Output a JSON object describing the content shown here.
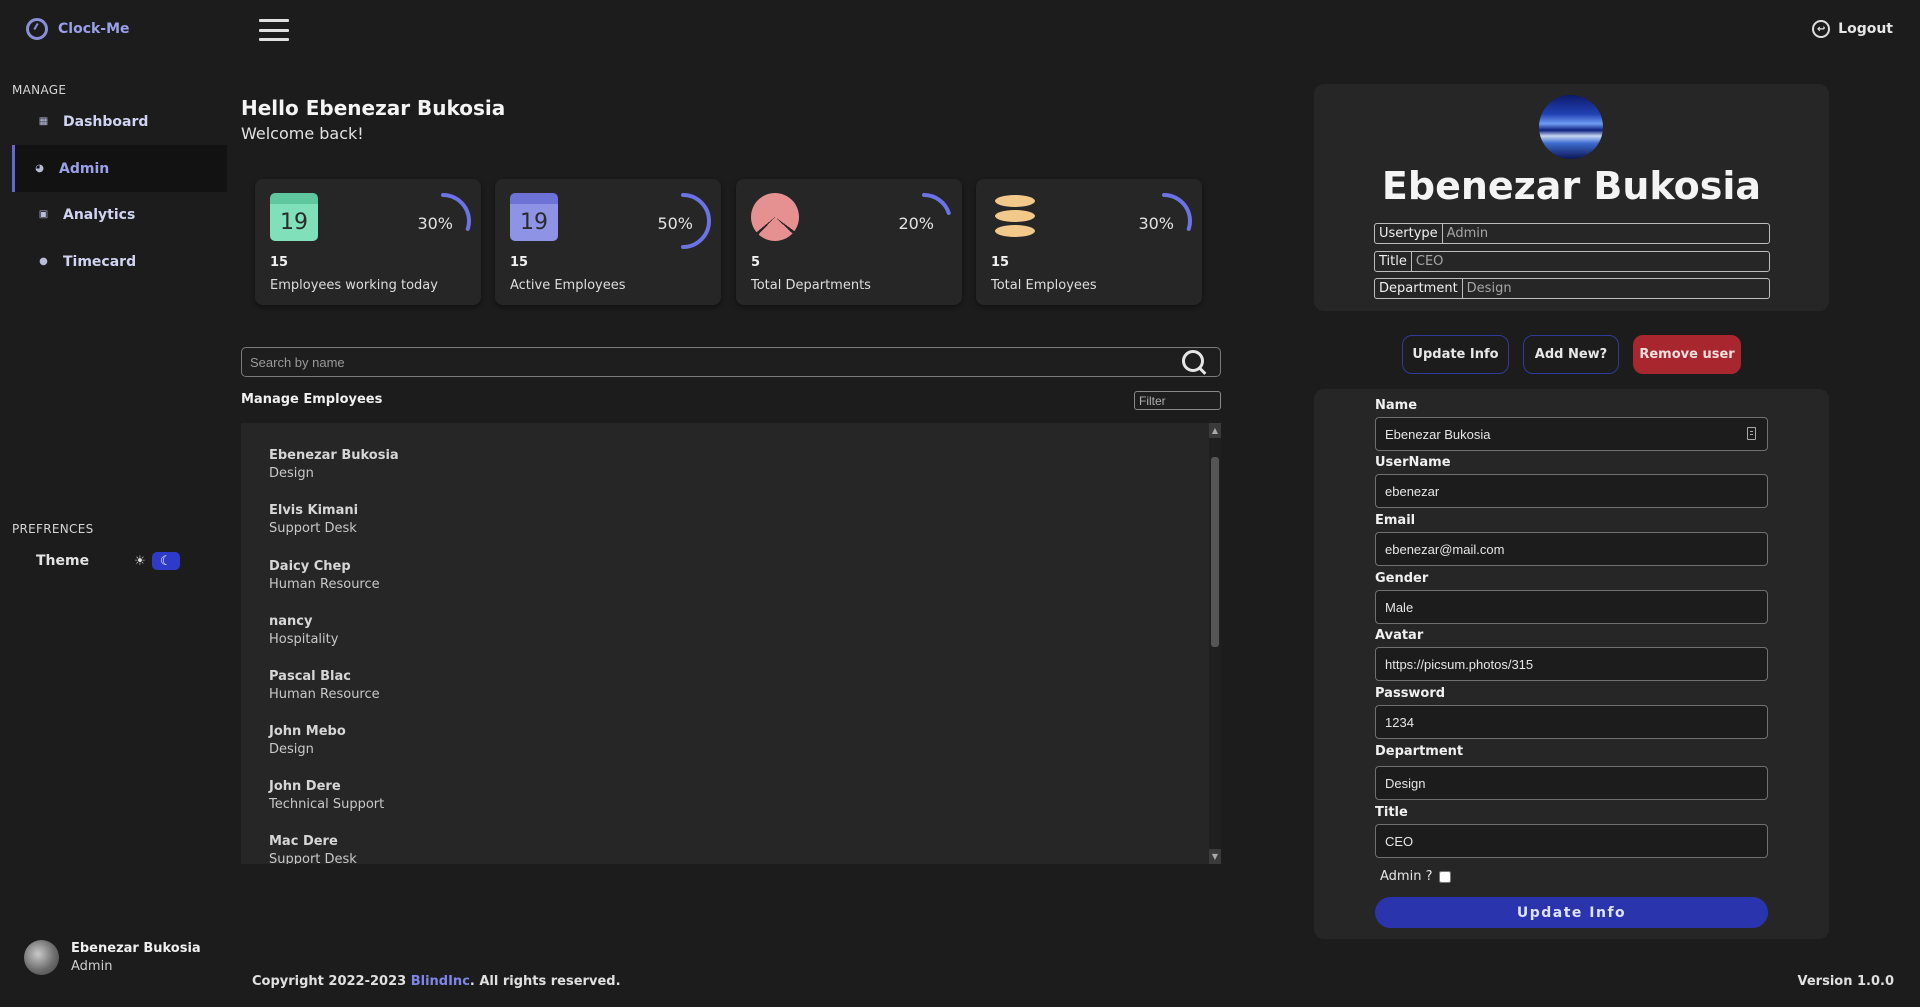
{
  "brand": {
    "name": "Clock-Me"
  },
  "header": {
    "logout_label": "Logout"
  },
  "sidebar": {
    "manage_title": "MANAGE",
    "items": [
      {
        "label": "Dashboard",
        "icon": "dashboard-icon"
      },
      {
        "label": "Admin",
        "icon": "admin-icon",
        "active": true
      },
      {
        "label": "Analytics",
        "icon": "analytics-icon"
      },
      {
        "label": "Timecard",
        "icon": "clock-icon"
      }
    ],
    "preferences_title": "PREFRENCES",
    "theme_label": "Theme",
    "user": {
      "name": "Ebenezar Bukosia",
      "role": "Admin"
    }
  },
  "main": {
    "greeting": "Hello Ebenezar Bukosia",
    "welcome": "Welcome back!",
    "stats": [
      {
        "icon": "calendar-icon",
        "icon_text": "19",
        "color": "#7fe0b9",
        "number": "15",
        "label": "Employees working today",
        "percent": "30%",
        "fraction": 0.3
      },
      {
        "icon": "calendar-icon",
        "icon_text": "19",
        "color": "#8e93e6",
        "number": "15",
        "label": "Active Employees",
        "percent": "50%",
        "fraction": 0.5
      },
      {
        "icon": "pie-chart-icon",
        "color": "#e59191",
        "number": "5",
        "label": "Total Departments",
        "percent": "20%",
        "fraction": 0.2
      },
      {
        "icon": "database-icon",
        "color": "#f2c98b",
        "number": "15",
        "label": "Total Employees",
        "percent": "30%",
        "fraction": 0.3
      }
    ],
    "search_placeholder": "Search by name",
    "manage_title": "Manage Employees",
    "filter_placeholder": "Filter",
    "employees": [
      {
        "name": "Ebenezar Bukosia",
        "department": "Design"
      },
      {
        "name": "Elvis Kimani",
        "department": "Support Desk"
      },
      {
        "name": "Daicy Chep",
        "department": "Human Resource"
      },
      {
        "name": "nancy",
        "department": "Hospitality"
      },
      {
        "name": "Pascal Blac",
        "department": "Human Resource"
      },
      {
        "name": "John Mebo",
        "department": "Design"
      },
      {
        "name": "John Dere",
        "department": "Technical Support"
      },
      {
        "name": "Mac Dere",
        "department": "Support Desk"
      }
    ]
  },
  "profile": {
    "name": "Ebenezar Bukosia",
    "info": [
      {
        "key": "Usertype",
        "value": "Admin"
      },
      {
        "key": "Title",
        "value": "CEO"
      },
      {
        "key": "Department",
        "value": "Design"
      }
    ],
    "buttons": {
      "update": "Update Info",
      "add": "Add New?",
      "remove": "Remove user"
    }
  },
  "form": {
    "fields": [
      {
        "label": "Name",
        "value": "Ebenezar Bukosia"
      },
      {
        "label": "UserName",
        "value": "ebenezar"
      },
      {
        "label": "Email",
        "value": "ebenezar@mail.com"
      },
      {
        "label": "Gender",
        "value": "Male"
      },
      {
        "label": "Avatar",
        "value": "https://picsum.photos/315"
      },
      {
        "label": "Password",
        "value": "1234"
      },
      {
        "label": "Department",
        "value": "Design"
      },
      {
        "label": "Title",
        "value": "CEO"
      }
    ],
    "admin_label": "Admin ?",
    "admin_checked": false,
    "submit_label": "Update Info"
  },
  "footer": {
    "copyright_prefix": "Copyright 2022-2023 ",
    "copyright_brand": "BlindInc",
    "copyright_suffix": ". All rights reserved.",
    "version": "Version 1.0.0"
  }
}
